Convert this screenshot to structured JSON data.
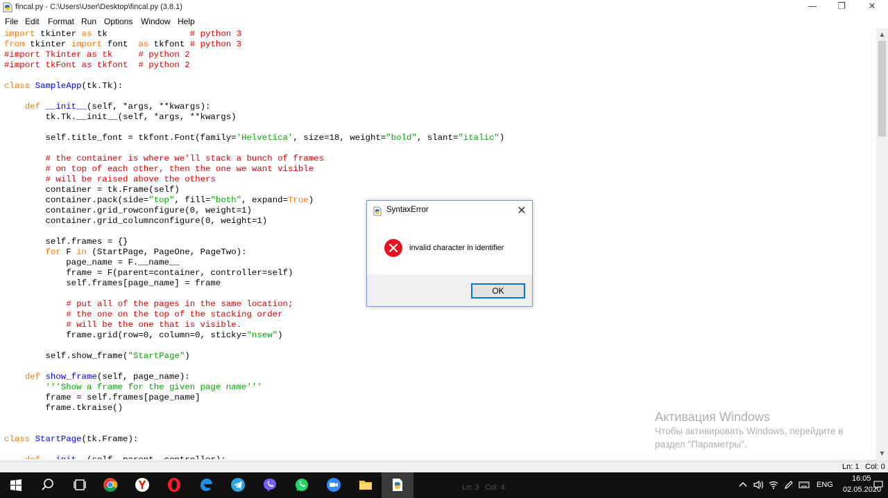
{
  "window": {
    "title": "fincal.py - C:\\Users\\User\\Desktop\\fincal.py (3.8.1)",
    "minimize_glyph": "—",
    "maximize_glyph": "❐",
    "close_glyph": "✕"
  },
  "menu": [
    "File",
    "Edit",
    "Format",
    "Run",
    "Options",
    "Window",
    "Help"
  ],
  "status": {
    "line": "Ln: 1",
    "col": "Col: 0"
  },
  "dialog": {
    "title": "SyntaxError",
    "message": "invalid character in identifier",
    "ok_label": "OK",
    "close_glyph": "✕",
    "icon": "error-icon"
  },
  "watermark": {
    "title": "Активация Windows",
    "line1": "Чтобы активировать Windows, перейдите в",
    "line2": "раздел \"Параметры\"."
  },
  "taskbar": {
    "apps": [
      "start",
      "search",
      "task-view",
      "chrome",
      "yandex",
      "opera",
      "edge",
      "telegram",
      "viber",
      "whatsapp",
      "zoom",
      "explorer",
      "python-idle"
    ],
    "ghost_line": "Ln: 3",
    "ghost_col": "Col: 4",
    "language": "ENG",
    "time": "16:05",
    "date": "02.05.2020"
  },
  "colors": {
    "keyword": "#ff7700",
    "builtin": "#900090",
    "string": "#00aa00",
    "comment": "#dd0000",
    "definition": "#0000ff",
    "error_red": "#e81123",
    "accent": "#0078d7"
  }
}
